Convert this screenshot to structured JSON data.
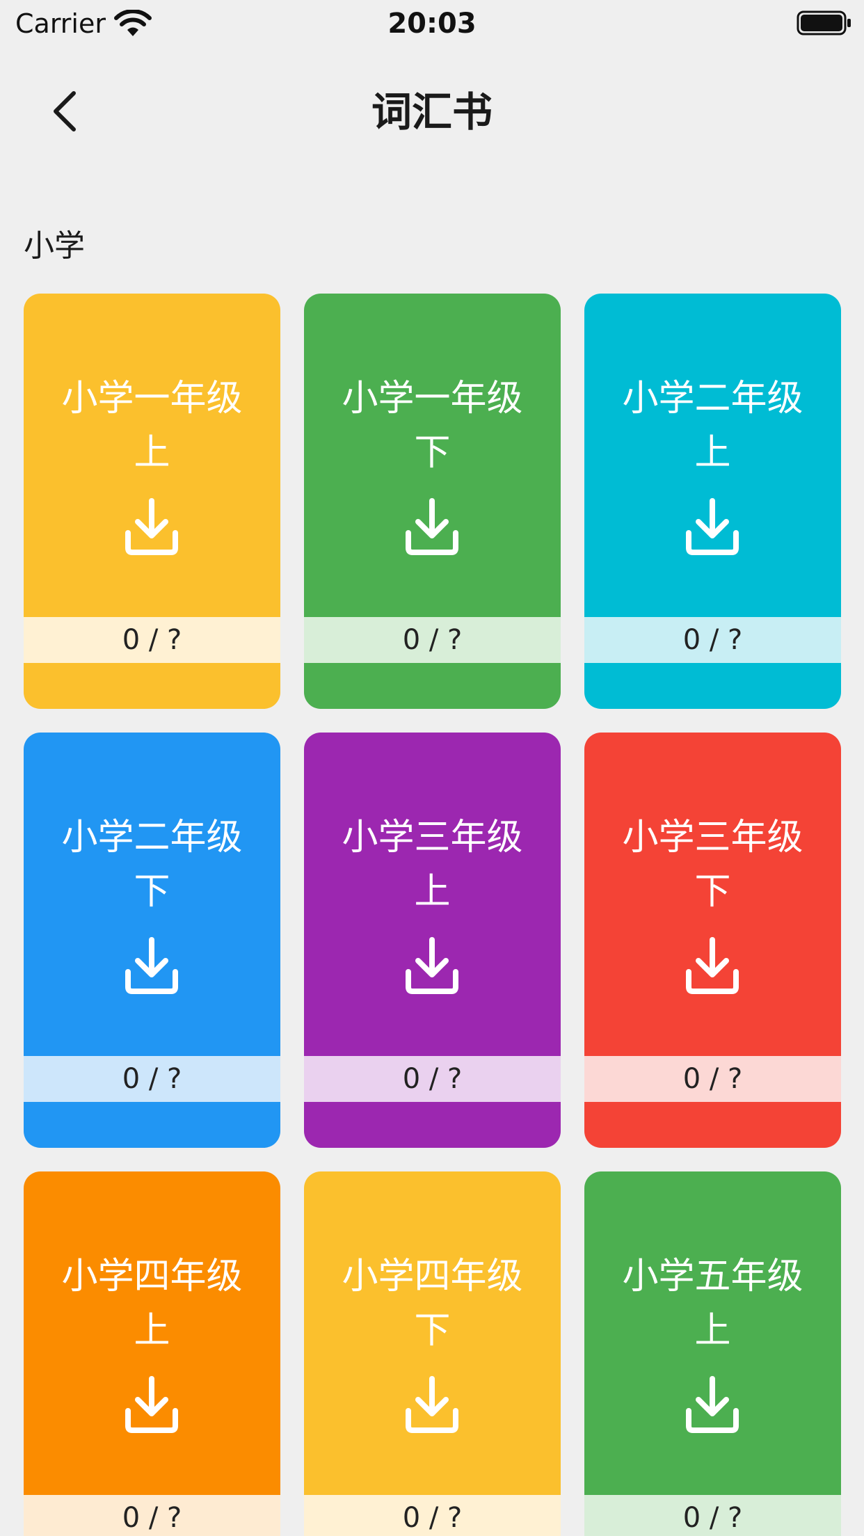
{
  "status_bar": {
    "carrier": "Carrier",
    "time": "20:03"
  },
  "nav": {
    "title": "词汇书"
  },
  "section": {
    "title": "小学"
  },
  "books": [
    {
      "line1": "小学一年级",
      "line2": "上",
      "progress": "0 / ?",
      "color": "#fbc02d",
      "strip": "#fff1d3"
    },
    {
      "line1": "小学一年级",
      "line2": "下",
      "progress": "0 / ?",
      "color": "#4caf50",
      "strip": "#d8eed8"
    },
    {
      "line1": "小学二年级",
      "line2": "上",
      "progress": "0 / ?",
      "color": "#00bcd4",
      "strip": "#c8eef4"
    },
    {
      "line1": "小学二年级",
      "line2": "下",
      "progress": "0 / ?",
      "color": "#2196f3",
      "strip": "#cde6fb"
    },
    {
      "line1": "小学三年级",
      "line2": "上",
      "progress": "0 / ?",
      "color": "#9c27b0",
      "strip": "#ead1ef"
    },
    {
      "line1": "小学三年级",
      "line2": "下",
      "progress": "0 / ?",
      "color": "#f44336",
      "strip": "#fcd8d5"
    },
    {
      "line1": "小学四年级",
      "line2": "上",
      "progress": "0 / ?",
      "color": "#fb8c00",
      "strip": "#feebd2"
    },
    {
      "line1": "小学四年级",
      "line2": "下",
      "progress": "0 / ?",
      "color": "#fbc02d",
      "strip": "#fff1d3"
    },
    {
      "line1": "小学五年级",
      "line2": "上",
      "progress": "0 / ?",
      "color": "#4caf50",
      "strip": "#d8eed8"
    }
  ]
}
